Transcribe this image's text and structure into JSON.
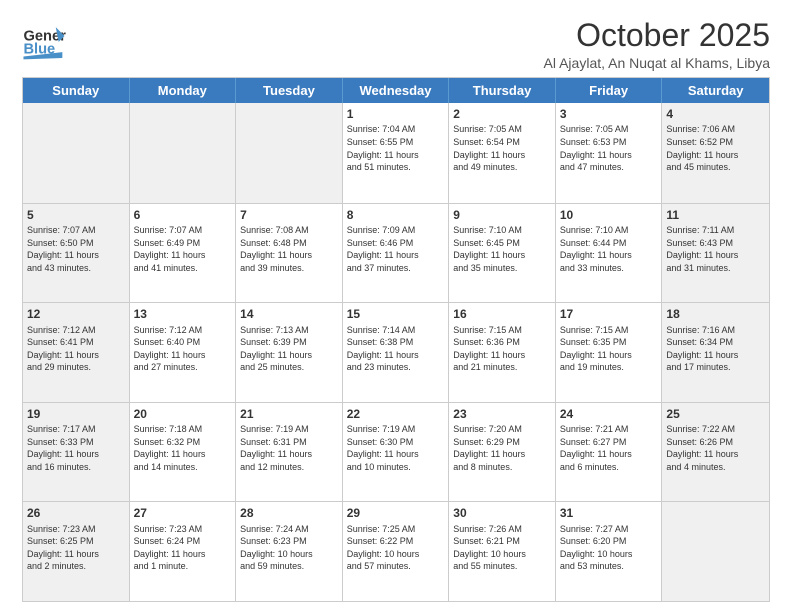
{
  "header": {
    "logo_general": "General",
    "logo_blue": "Blue",
    "month": "October 2025",
    "location": "Al Ajaylat, An Nuqat al Khams, Libya"
  },
  "days_of_week": [
    "Sunday",
    "Monday",
    "Tuesday",
    "Wednesday",
    "Thursday",
    "Friday",
    "Saturday"
  ],
  "weeks": [
    [
      {
        "day": "",
        "info": "",
        "shaded": true
      },
      {
        "day": "",
        "info": "",
        "shaded": true
      },
      {
        "day": "",
        "info": "",
        "shaded": true
      },
      {
        "day": "1",
        "info": "Sunrise: 7:04 AM\nSunset: 6:55 PM\nDaylight: 11 hours\nand 51 minutes.",
        "shaded": false
      },
      {
        "day": "2",
        "info": "Sunrise: 7:05 AM\nSunset: 6:54 PM\nDaylight: 11 hours\nand 49 minutes.",
        "shaded": false
      },
      {
        "day": "3",
        "info": "Sunrise: 7:05 AM\nSunset: 6:53 PM\nDaylight: 11 hours\nand 47 minutes.",
        "shaded": false
      },
      {
        "day": "4",
        "info": "Sunrise: 7:06 AM\nSunset: 6:52 PM\nDaylight: 11 hours\nand 45 minutes.",
        "shaded": true
      }
    ],
    [
      {
        "day": "5",
        "info": "Sunrise: 7:07 AM\nSunset: 6:50 PM\nDaylight: 11 hours\nand 43 minutes.",
        "shaded": true
      },
      {
        "day": "6",
        "info": "Sunrise: 7:07 AM\nSunset: 6:49 PM\nDaylight: 11 hours\nand 41 minutes.",
        "shaded": false
      },
      {
        "day": "7",
        "info": "Sunrise: 7:08 AM\nSunset: 6:48 PM\nDaylight: 11 hours\nand 39 minutes.",
        "shaded": false
      },
      {
        "day": "8",
        "info": "Sunrise: 7:09 AM\nSunset: 6:46 PM\nDaylight: 11 hours\nand 37 minutes.",
        "shaded": false
      },
      {
        "day": "9",
        "info": "Sunrise: 7:10 AM\nSunset: 6:45 PM\nDaylight: 11 hours\nand 35 minutes.",
        "shaded": false
      },
      {
        "day": "10",
        "info": "Sunrise: 7:10 AM\nSunset: 6:44 PM\nDaylight: 11 hours\nand 33 minutes.",
        "shaded": false
      },
      {
        "day": "11",
        "info": "Sunrise: 7:11 AM\nSunset: 6:43 PM\nDaylight: 11 hours\nand 31 minutes.",
        "shaded": true
      }
    ],
    [
      {
        "day": "12",
        "info": "Sunrise: 7:12 AM\nSunset: 6:41 PM\nDaylight: 11 hours\nand 29 minutes.",
        "shaded": true
      },
      {
        "day": "13",
        "info": "Sunrise: 7:12 AM\nSunset: 6:40 PM\nDaylight: 11 hours\nand 27 minutes.",
        "shaded": false
      },
      {
        "day": "14",
        "info": "Sunrise: 7:13 AM\nSunset: 6:39 PM\nDaylight: 11 hours\nand 25 minutes.",
        "shaded": false
      },
      {
        "day": "15",
        "info": "Sunrise: 7:14 AM\nSunset: 6:38 PM\nDaylight: 11 hours\nand 23 minutes.",
        "shaded": false
      },
      {
        "day": "16",
        "info": "Sunrise: 7:15 AM\nSunset: 6:36 PM\nDaylight: 11 hours\nand 21 minutes.",
        "shaded": false
      },
      {
        "day": "17",
        "info": "Sunrise: 7:15 AM\nSunset: 6:35 PM\nDaylight: 11 hours\nand 19 minutes.",
        "shaded": false
      },
      {
        "day": "18",
        "info": "Sunrise: 7:16 AM\nSunset: 6:34 PM\nDaylight: 11 hours\nand 17 minutes.",
        "shaded": true
      }
    ],
    [
      {
        "day": "19",
        "info": "Sunrise: 7:17 AM\nSunset: 6:33 PM\nDaylight: 11 hours\nand 16 minutes.",
        "shaded": true
      },
      {
        "day": "20",
        "info": "Sunrise: 7:18 AM\nSunset: 6:32 PM\nDaylight: 11 hours\nand 14 minutes.",
        "shaded": false
      },
      {
        "day": "21",
        "info": "Sunrise: 7:19 AM\nSunset: 6:31 PM\nDaylight: 11 hours\nand 12 minutes.",
        "shaded": false
      },
      {
        "day": "22",
        "info": "Sunrise: 7:19 AM\nSunset: 6:30 PM\nDaylight: 11 hours\nand 10 minutes.",
        "shaded": false
      },
      {
        "day": "23",
        "info": "Sunrise: 7:20 AM\nSunset: 6:29 PM\nDaylight: 11 hours\nand 8 minutes.",
        "shaded": false
      },
      {
        "day": "24",
        "info": "Sunrise: 7:21 AM\nSunset: 6:27 PM\nDaylight: 11 hours\nand 6 minutes.",
        "shaded": false
      },
      {
        "day": "25",
        "info": "Sunrise: 7:22 AM\nSunset: 6:26 PM\nDaylight: 11 hours\nand 4 minutes.",
        "shaded": true
      }
    ],
    [
      {
        "day": "26",
        "info": "Sunrise: 7:23 AM\nSunset: 6:25 PM\nDaylight: 11 hours\nand 2 minutes.",
        "shaded": true
      },
      {
        "day": "27",
        "info": "Sunrise: 7:23 AM\nSunset: 6:24 PM\nDaylight: 11 hours\nand 1 minute.",
        "shaded": false
      },
      {
        "day": "28",
        "info": "Sunrise: 7:24 AM\nSunset: 6:23 PM\nDaylight: 10 hours\nand 59 minutes.",
        "shaded": false
      },
      {
        "day": "29",
        "info": "Sunrise: 7:25 AM\nSunset: 6:22 PM\nDaylight: 10 hours\nand 57 minutes.",
        "shaded": false
      },
      {
        "day": "30",
        "info": "Sunrise: 7:26 AM\nSunset: 6:21 PM\nDaylight: 10 hours\nand 55 minutes.",
        "shaded": false
      },
      {
        "day": "31",
        "info": "Sunrise: 7:27 AM\nSunset: 6:20 PM\nDaylight: 10 hours\nand 53 minutes.",
        "shaded": false
      },
      {
        "day": "",
        "info": "",
        "shaded": true
      }
    ]
  ]
}
